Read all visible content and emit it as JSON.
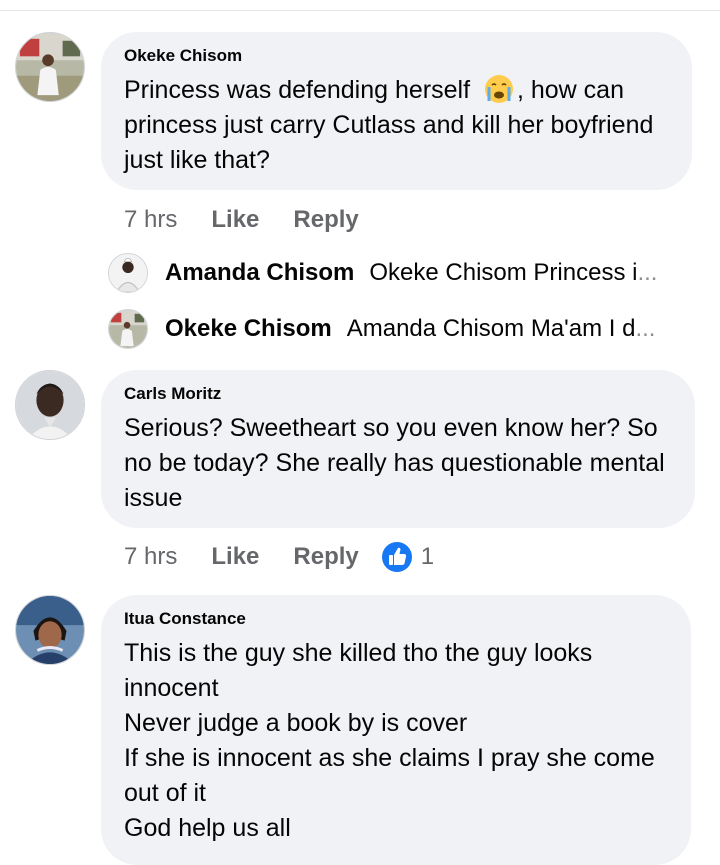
{
  "comments": [
    {
      "author": "Okeke Chisom",
      "text_before_emoji": "Princess was defending herself ",
      "emoji": "crying-face-emoji",
      "text_after_emoji": ", how can princess just carry Cutlass and kill her boyfriend just like that?",
      "time": "7 hrs",
      "like_label": "Like",
      "reply_label": "Reply",
      "replies": [
        {
          "author": "Amanda Chisom",
          "preview": "Okeke Chisom Princess i",
          "ellipsis": "..."
        },
        {
          "author": "Okeke Chisom",
          "preview": "Amanda Chisom Ma'am I d",
          "ellipsis": "..."
        }
      ]
    },
    {
      "author": "Carls Moritz",
      "text": "Serious? Sweetheart so you even know her?  So no be today? She really has questionable mental issue",
      "time": "7 hrs",
      "like_label": "Like",
      "reply_label": "Reply",
      "reaction_count": "1"
    },
    {
      "author": "Itua Constance",
      "text": "This is the guy she killed tho the guy looks innocent\nNever judge a book by is cover\nIf she is innocent as she claims I pray she come out of it\nGod help us all"
    }
  ],
  "colors": {
    "bubble": "#f0f2f5",
    "meta_text": "#65676b",
    "like_blue": "#1877f2"
  }
}
